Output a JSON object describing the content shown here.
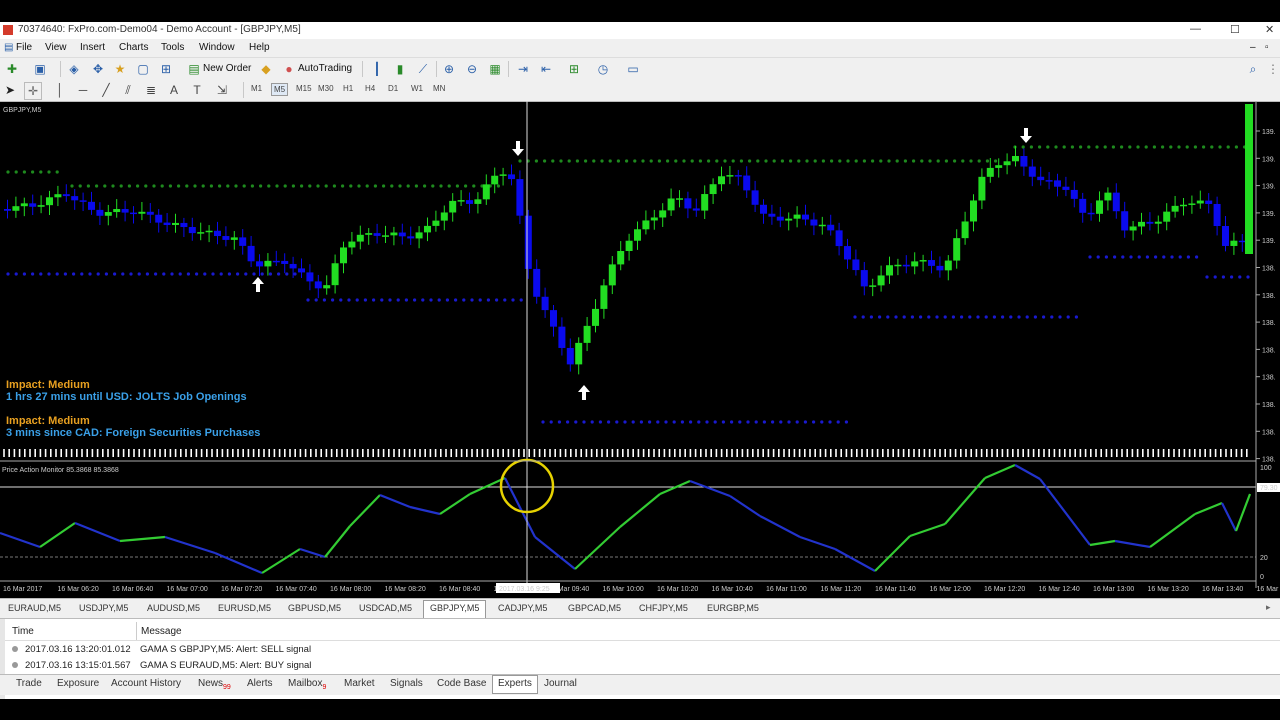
{
  "window": {
    "title": "70374640: FxPro.com-Demo04 - Demo Account - [GBPJPY,M5]"
  },
  "menu": [
    "File",
    "View",
    "Insert",
    "Charts",
    "Tools",
    "Window",
    "Help"
  ],
  "toolbar": {
    "new_order": "New Order",
    "autotrading": "AutoTrading"
  },
  "timeframes": [
    "M1",
    "M5",
    "M15",
    "M30",
    "H1",
    "H4",
    "D1",
    "W1",
    "MN"
  ],
  "active_timeframe": "M5",
  "chart": {
    "symbol_label": "GBPJPY,M5",
    "indicator_label": "Price Action Monitor 85.3868 85.3868",
    "price_labels": [
      "139.",
      "139.",
      "139.",
      "139.",
      "139.",
      "138.",
      "138.",
      "138.",
      "138.",
      "138.",
      "138.",
      "138.",
      "138."
    ],
    "indicator_levels": {
      "top": "100",
      "mid": "79.30",
      "low": "20",
      "bottom": "0"
    },
    "time_labels": [
      "16 Mar 2017",
      "16 Mar 06:20",
      "16 Mar 06:40",
      "16 Mar 07:00",
      "16 Mar 07:20",
      "16 Mar 07:40",
      "16 Mar 08:00",
      "16 Mar 08:20",
      "16 Mar 08:40",
      "16 Mar 0",
      "16 Mar 09:40",
      "16 Mar 10:00",
      "16 Mar 10:20",
      "16 Mar 10:40",
      "16 Mar 11:00",
      "16 Mar 11:20",
      "16 Mar 11:40",
      "16 Mar 12:00",
      "16 Mar 12:20",
      "16 Mar 12:40",
      "16 Mar 13:00",
      "16 Mar 13:20",
      "16 Mar 13:40",
      "16 Mar 1"
    ],
    "crosshair_time": "2017.03.16 9:25",
    "news": [
      {
        "impact": "Impact: Medium",
        "text": "1 hrs 27 mins until USD: JOLTS Job Openings"
      },
      {
        "impact": "Impact: Medium",
        "text": "3 mins since CAD: Foreign Securities Purchases"
      }
    ],
    "colors": {
      "bull": "#22dd22",
      "bear": "#0a0aee",
      "impact": "#e8a020",
      "news": "#3aa0e8",
      "dots_up": "#1e8a1e",
      "dots_down": "#1a1ad0",
      "indicator_up": "#33cc33",
      "indicator_down": "#2233cc"
    }
  },
  "symbol_tabs": [
    "EURAUD,M5",
    "USDJPY,M5",
    "AUDUSD,M5",
    "EURUSD,M5",
    "GBPUSD,M5",
    "USDCAD,M5",
    "GBPJPY,M5",
    "CADJPY,M5",
    "GBPCAD,M5",
    "CHFJPY,M5",
    "EURGBP,M5"
  ],
  "active_symbol_tab": "GBPJPY,M5",
  "terminal": {
    "headers": {
      "time": "Time",
      "message": "Message"
    },
    "rows": [
      {
        "time": "2017.03.16 13:20:01.012",
        "message": "GAMA S GBPJPY,M5: Alert: SELL signal"
      },
      {
        "time": "2017.03.16 13:15:01.567",
        "message": "GAMA S EURAUD,M5: Alert: BUY signal"
      }
    ]
  },
  "bottom_tabs": [
    {
      "label": "Trade"
    },
    {
      "label": "Exposure"
    },
    {
      "label": "Account History"
    },
    {
      "label": "News",
      "badge": "99"
    },
    {
      "label": "Alerts"
    },
    {
      "label": "Mailbox",
      "badge": "9"
    },
    {
      "label": "Market"
    },
    {
      "label": "Signals"
    },
    {
      "label": "Code Base"
    },
    {
      "label": "Experts"
    },
    {
      "label": "Journal"
    }
  ],
  "active_bottom_tab": "Experts"
}
